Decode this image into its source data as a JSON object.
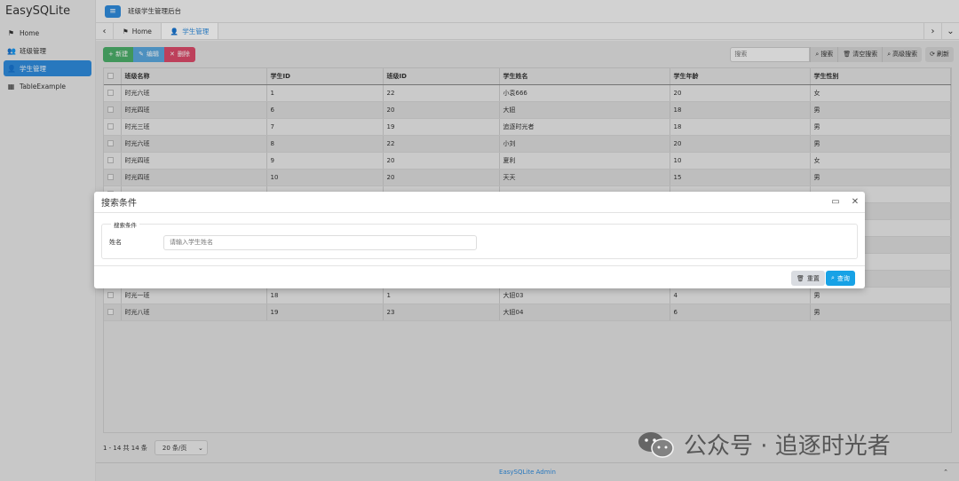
{
  "app": {
    "brand": "EasySQLite",
    "top_title": "班级学生管理后台"
  },
  "sidebar": {
    "items": [
      {
        "label": "Home",
        "icon": "flag-icon",
        "active": false
      },
      {
        "label": "班级管理",
        "icon": "users-icon",
        "active": false
      },
      {
        "label": "学生管理",
        "icon": "user-icon",
        "active": true
      },
      {
        "label": "TableExample",
        "icon": "table-icon",
        "active": false
      }
    ]
  },
  "tabs": {
    "items": [
      {
        "label": "Home",
        "icon": "flag-icon"
      },
      {
        "label": "学生管理",
        "icon": "user-icon",
        "active": true
      }
    ]
  },
  "toolbar": {
    "add_label": "+ 新建",
    "edit_label": "编辑",
    "delete_label": "删除",
    "search_placeholder": "搜索",
    "search_label": "搜索",
    "clear_label": "清空搜索",
    "advanced_label": "高级搜索",
    "refresh_label": "刷新"
  },
  "table": {
    "columns": [
      "班级名称",
      "学生ID",
      "班级ID",
      "学生姓名",
      "学生年龄",
      "学生性别"
    ],
    "rows": [
      [
        "时光六班",
        "1",
        "22",
        "小袁666",
        "20",
        "女"
      ],
      [
        "时光四班",
        "6",
        "20",
        "大妞",
        "18",
        "男"
      ],
      [
        "时光三班",
        "7",
        "19",
        "追逐时光者",
        "18",
        "男"
      ],
      [
        "时光六班",
        "8",
        "22",
        "小刘",
        "20",
        "男"
      ],
      [
        "时光四班",
        "9",
        "20",
        "夏利",
        "10",
        "女"
      ],
      [
        "时光四班",
        "10",
        "20",
        "天天",
        "15",
        "男"
      ],
      [
        "",
        "",
        "",
        "",
        "",
        ""
      ],
      [
        "",
        "",
        "",
        "",
        "",
        ""
      ],
      [
        "",
        "",
        "",
        "",
        "",
        ""
      ],
      [
        "",
        "",
        "",
        "",
        "",
        ""
      ],
      [
        "",
        "",
        "",
        "",
        "",
        ""
      ],
      [
        "",
        "",
        "",
        "",
        "",
        ""
      ],
      [
        "时光一班",
        "18",
        "1",
        "大妞03",
        "4",
        "男"
      ],
      [
        "时光八班",
        "19",
        "23",
        "大妞04",
        "6",
        "男"
      ]
    ]
  },
  "pager": {
    "summary": "1 - 14 共 14 条",
    "page_size": "20 条/页"
  },
  "footer": {
    "text": "EasySQLite Admin"
  },
  "modal": {
    "title": "搜索条件",
    "legend": "搜索条件",
    "field_label": "姓名",
    "field_placeholder": "请输入学生姓名",
    "reset_label": "重置",
    "query_label": "查询"
  },
  "watermark": {
    "text": "公众号 · 追逐时光者"
  },
  "colors": {
    "accent": "#2f8cde",
    "add": "#4caf6a",
    "edit": "#5aa8df",
    "delete": "#dd4b6a",
    "query": "#17a2e6"
  }
}
